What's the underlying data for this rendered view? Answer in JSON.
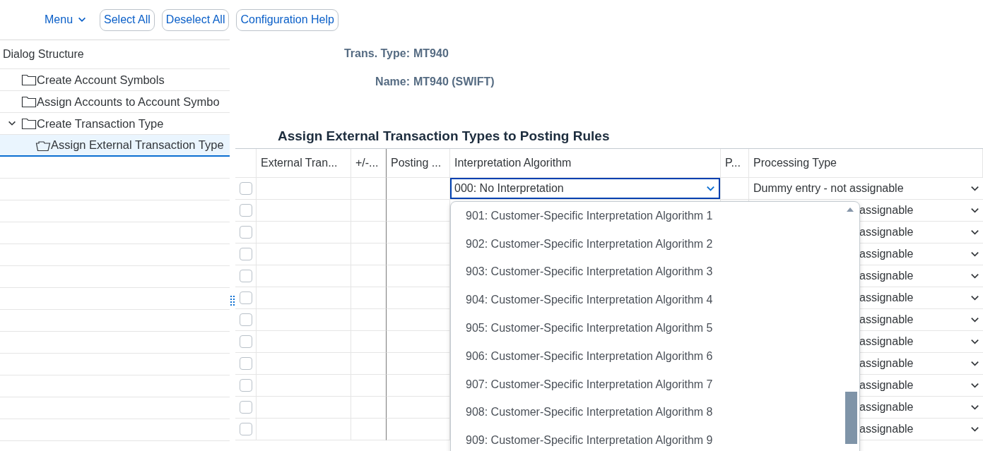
{
  "toolbar": {
    "menu": "Menu",
    "buttons": [
      "Select All",
      "Deselect All",
      "Configuration Help"
    ]
  },
  "dialog_structure": {
    "title": "Dialog Structure",
    "items": [
      {
        "label": "Create Account Symbols",
        "expanded": false,
        "selected": false
      },
      {
        "label": "Assign Accounts to Account Symbo",
        "expanded": false,
        "selected": false
      },
      {
        "label": "Create Transaction Type",
        "expanded": true,
        "selected": false,
        "children": [
          {
            "label": "Assign External Transaction Type",
            "expanded": false,
            "selected": true
          }
        ]
      }
    ]
  },
  "header_fields": [
    {
      "label": "Trans. Type:",
      "value": "MT940"
    },
    {
      "label": "Name:",
      "value": "MT940 (SWIFT)"
    }
  ],
  "table": {
    "title": "Assign External Transaction Types to Posting Rules",
    "columns": [
      "External Tran...",
      "+/-...",
      "Posting ...",
      "Interpretation Algorithm",
      "P...",
      "Processing Type"
    ],
    "rows": [
      {
        "selected": false,
        "interpretation": "000: No Interpretation",
        "processing_type": "Dummy entry - not assignable"
      },
      {
        "selected": false,
        "processing_type": "assignable"
      },
      {
        "selected": false,
        "processing_type": "assignable"
      },
      {
        "selected": false,
        "processing_type": "assignable"
      },
      {
        "selected": false,
        "processing_type": "assignable"
      },
      {
        "selected": false,
        "processing_type": "assignable"
      },
      {
        "selected": false,
        "processing_type": "assignable"
      },
      {
        "selected": false,
        "processing_type": "assignable"
      },
      {
        "selected": false,
        "processing_type": "assignable"
      },
      {
        "selected": false,
        "processing_type": "assignable"
      },
      {
        "selected": false,
        "processing_type": "assignable"
      },
      {
        "selected": false,
        "processing_type": "assignable"
      }
    ]
  },
  "dropdown": {
    "open": true,
    "items": [
      {
        "label": "901: Customer-Specific Interpretation Algorithm 1",
        "selected": false
      },
      {
        "label": "902: Customer-Specific Interpretation Algorithm 2",
        "selected": false
      },
      {
        "label": "903: Customer-Specific Interpretation Algorithm 3",
        "selected": false
      },
      {
        "label": "904: Customer-Specific Interpretation Algorithm 4",
        "selected": false
      },
      {
        "label": "905: Customer-Specific Interpretation Algorithm 5",
        "selected": false
      },
      {
        "label": "906: Customer-Specific Interpretation Algorithm 6",
        "selected": false
      },
      {
        "label": "907: Customer-Specific Interpretation Algorithm 7",
        "selected": false
      },
      {
        "label": "908: Customer-Specific Interpretation Algorithm 8",
        "selected": false
      },
      {
        "label": "909: Customer-Specific Interpretation Algorithm 9",
        "selected": false
      }
    ]
  }
}
